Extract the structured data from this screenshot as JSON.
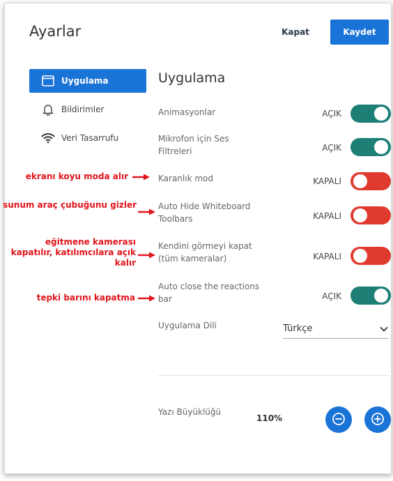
{
  "header": {
    "title": "Ayarlar",
    "close_label": "Kapat",
    "save_label": "Kaydet"
  },
  "sidebar": {
    "items": [
      {
        "label": "Uygulama",
        "icon": "window-icon",
        "active": true
      },
      {
        "label": "Bildirimler",
        "icon": "bell-icon",
        "active": false
      },
      {
        "label": "Veri Tasarrufu",
        "icon": "wifi-icon",
        "active": false
      }
    ]
  },
  "main": {
    "section_title": "Uygulama",
    "settings": [
      {
        "label": "Animasyonlar",
        "state": "AÇIK",
        "on": true
      },
      {
        "label": "Mikrofon için Ses Filtreleri",
        "state": "AÇIK",
        "on": true
      },
      {
        "label": "Karanlık mod",
        "state": "KAPALI",
        "on": false
      },
      {
        "label": "Auto Hide Whiteboard Toolbars",
        "state": "KAPALI",
        "on": false
      },
      {
        "label": "Kendini görmeyi kapat (tüm kameralar)",
        "state": "KAPALI",
        "on": false
      },
      {
        "label": "Auto close the reactions bar",
        "state": "AÇIK",
        "on": true
      }
    ],
    "language": {
      "label": "Uygulama Dili",
      "value": "Türkçe"
    },
    "font_size": {
      "label": "Yazı Büyüklüğü",
      "value": "110%"
    }
  },
  "annotations": [
    {
      "text": "ekranı koyu moda alır"
    },
    {
      "text": "sunum araç çubuğunu gizler"
    },
    {
      "text": "eğitmene kamerası kapatılır, katılımcılara açık kalır"
    },
    {
      "text": "tepki barını kapatma"
    }
  ],
  "colors": {
    "accent": "#1a73d6",
    "toggle_on": "#1d7f76",
    "toggle_off": "#e03a2f",
    "annotation": "#e0141b"
  }
}
